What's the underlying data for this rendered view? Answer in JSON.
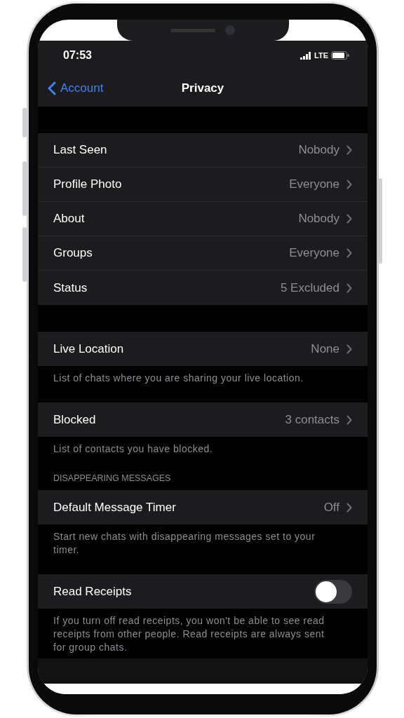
{
  "status_bar": {
    "time": "07:53",
    "network": "LTE"
  },
  "nav": {
    "back": "Account",
    "title": "Privacy"
  },
  "sections": [
    {
      "rows": [
        {
          "kind": "link",
          "label": "Last Seen",
          "value": "Nobody"
        },
        {
          "kind": "link",
          "label": "Profile Photo",
          "value": "Everyone"
        },
        {
          "kind": "link",
          "label": "About",
          "value": "Nobody"
        },
        {
          "kind": "link",
          "label": "Groups",
          "value": "Everyone"
        },
        {
          "kind": "link",
          "label": "Status",
          "value": "5 Excluded"
        }
      ]
    },
    {
      "rows": [
        {
          "kind": "link",
          "label": "Live Location",
          "value": "None"
        }
      ],
      "footer": "List of chats where you are sharing your live location."
    },
    {
      "rows": [
        {
          "kind": "link",
          "label": "Blocked",
          "value": "3 contacts"
        }
      ],
      "footer": "List of contacts you have blocked."
    },
    {
      "header": "DISAPPEARING MESSAGES",
      "rows": [
        {
          "kind": "link",
          "label": "Default Message Timer",
          "value": "Off"
        }
      ],
      "footer": "Start new chats with disappearing messages set to your timer."
    },
    {
      "rows": [
        {
          "kind": "toggle",
          "label": "Read Receipts",
          "on": false
        }
      ],
      "footer": "If you turn off read receipts, you won't be able to see read receipts from other people. Read receipts are always sent for group chats."
    }
  ]
}
